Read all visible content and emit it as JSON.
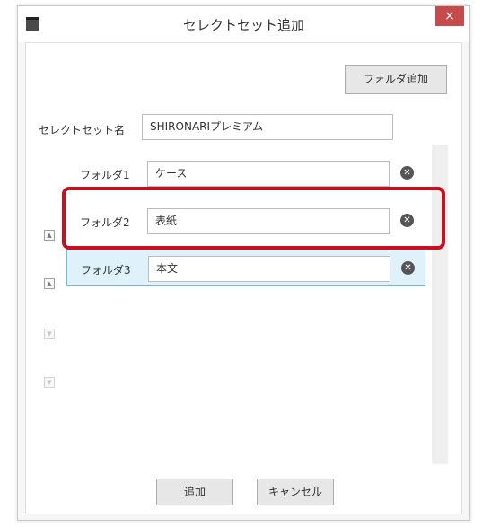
{
  "dialog": {
    "title": "セレクトセット追加",
    "close_glyph": "×"
  },
  "toolbar": {
    "add_folder_label": "フォルダ追加"
  },
  "select_set": {
    "name_label": "セレクトセット名",
    "name_value": "SHIRONARIプレミアム"
  },
  "folders": [
    {
      "label": "フォルダ1",
      "value": "ケース"
    },
    {
      "label": "フォルダ2",
      "value": "表紙"
    },
    {
      "label": "フォルダ3",
      "value": "本文"
    }
  ],
  "icons": {
    "remove": "remove-circle-icon",
    "move_top": "move-top-icon",
    "move_up": "move-up-icon",
    "move_down": "move-down-icon",
    "move_bottom": "move-bottom-icon"
  },
  "footer": {
    "ok_label": "追加",
    "cancel_label": "キャンセル"
  },
  "colors": {
    "highlight": "#c8101e",
    "selected_row": "#dff1fb",
    "close": "#c74b4b"
  }
}
